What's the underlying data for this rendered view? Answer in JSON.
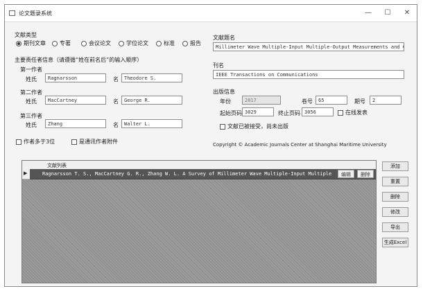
{
  "window": {
    "title": "论文题录系统",
    "minimize": "—",
    "maximize": "☐",
    "close": "✕"
  },
  "doc_type": {
    "label": "文献类型",
    "options": [
      {
        "label": "期刊文章",
        "selected": true
      },
      {
        "label": "专著",
        "selected": false
      },
      {
        "label": "会议论文",
        "selected": false
      },
      {
        "label": "学位论文",
        "selected": false
      },
      {
        "label": "标准",
        "selected": false
      },
      {
        "label": "报告",
        "selected": false
      }
    ]
  },
  "authors": {
    "hint": "主要责任者信息（请遵循“姓在前名后”的输入顺序）",
    "groups": [
      {
        "label": "第一作者",
        "surname_label": "姓氏",
        "surname": "Ragnarsson",
        "given_label": "名",
        "given": "Theodore S."
      },
      {
        "label": "第二作者",
        "surname_label": "姓氏",
        "surname": "MacCartney",
        "given_label": "名",
        "given": "George R."
      },
      {
        "label": "第三作者",
        "surname_label": "姓氏",
        "surname": "Zhang",
        "given_label": "名",
        "given": "Walter L."
      }
    ],
    "checkbox_more": "作者多于3位",
    "checkbox_corr": "是通讯作者附件"
  },
  "doc_title": {
    "label": "文献题名",
    "value": "Millimeter Wave Multiple-Input Multiple-Output Measurements and Channel Models for Future Wireless"
  },
  "journal": {
    "label": "刊名",
    "value": "IEEE Transactions on Communications"
  },
  "pub_info": {
    "label": "出版信息",
    "year_label": "年份",
    "year": "2017",
    "volume_label": "卷号",
    "volume": "65",
    "issue_label": "期号",
    "issue": "2",
    "start_label": "起始页码",
    "start": "3029",
    "end_label": "终止页码",
    "end": "3056",
    "online_label": "在线发表",
    "advance_label": "文献已被接受，尚未出版"
  },
  "copyright": "Copyright © Academic Journals Center at Shanghai Maritime University",
  "table": {
    "header": "文献列表",
    "rows": [
      {
        "marker": "▶",
        "text": "Ragnarsson T. S., MacCartney G. R., Zhang W. L. A Survey of Millimeter Wave Multiple-Input Multiple-Output Measurements and Channel Models",
        "edit": "编辑",
        "delete": "删除"
      }
    ]
  },
  "side_buttons": [
    "添加",
    "重置",
    "删除",
    "修改",
    "导出",
    "生成Excel"
  ]
}
